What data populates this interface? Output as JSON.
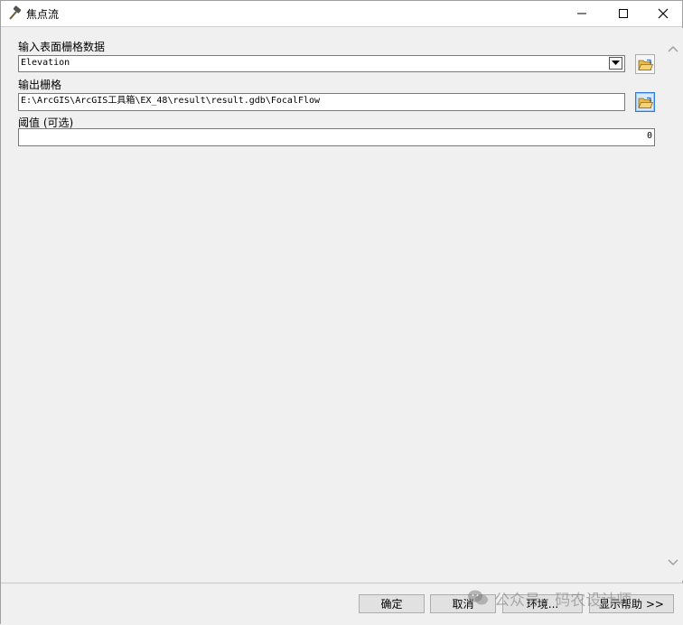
{
  "window": {
    "title": "焦点流",
    "icon": "hammer-icon"
  },
  "form": {
    "input_raster": {
      "label": "输入表面栅格数据",
      "value": "Elevation"
    },
    "output_raster": {
      "label": "输出栅格",
      "value": "E:\\ArcGIS\\ArcGIS工具箱\\EX_48\\result\\result.gdb\\FocalFlow"
    },
    "threshold": {
      "label": "阈值 (可选)",
      "value": "0"
    }
  },
  "buttons": {
    "ok": "确定",
    "cancel": "取消",
    "environments": "环境...",
    "show_help": "显示帮助 >>"
  },
  "watermark": {
    "text": "公众号 · 码农设计师",
    "icon": "wechat-icon"
  },
  "colors": {
    "window_bg": "#f0f0f0",
    "titlebar_bg": "#ffffff",
    "active_button_border": "#2f7bd9",
    "folder_icon": "#e8b84a"
  }
}
